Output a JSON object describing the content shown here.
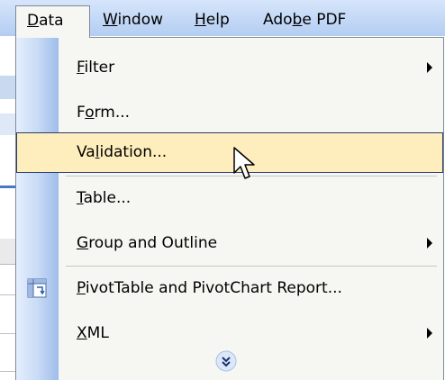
{
  "menubar": {
    "items": [
      {
        "before": "",
        "mnemonic": "D",
        "after": "ata"
      },
      {
        "before": "",
        "mnemonic": "W",
        "after": "indow"
      },
      {
        "before": "",
        "mnemonic": "H",
        "after": "elp"
      },
      {
        "before": "Ado",
        "mnemonic": "b",
        "after": "e PDF"
      }
    ]
  },
  "menu": {
    "items": [
      {
        "before": "",
        "mnemonic": "F",
        "after": "ilter",
        "has_submenu": true
      },
      {
        "before": "F",
        "mnemonic": "o",
        "after": "rm...",
        "has_submenu": false
      },
      {
        "before": "Va",
        "mnemonic": "l",
        "after": "idation...",
        "has_submenu": false,
        "highlighted": true
      },
      {
        "before": "",
        "mnemonic": "T",
        "after": "able...",
        "has_submenu": false
      },
      {
        "before": "",
        "mnemonic": "G",
        "after": "roup and Outline",
        "has_submenu": true
      },
      {
        "before": "",
        "mnemonic": "P",
        "after": "ivotTable and PivotChart Report...",
        "has_submenu": false,
        "icon": "pivottable-icon"
      },
      {
        "before": "",
        "mnemonic": "X",
        "after": "ML",
        "has_submenu": true
      }
    ],
    "expand_icon": "double-chevron-down-icon"
  },
  "colors": {
    "menubar_bg": "#c3d8f6",
    "menu_bg": "#f6f7f2",
    "highlight_bg": "#ffeebd",
    "highlight_border": "#2a3d6d",
    "gutter": "#c9dbf6"
  }
}
